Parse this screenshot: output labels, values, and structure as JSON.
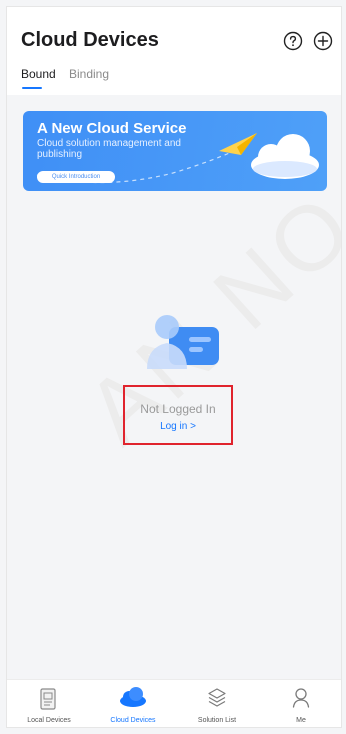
{
  "header": {
    "title": "Cloud Devices",
    "tabs": [
      {
        "label": "Bound",
        "active": true
      },
      {
        "label": "Binding",
        "active": false
      }
    ],
    "icons": [
      "help-circle-icon",
      "add-circle-icon"
    ]
  },
  "banner": {
    "title": "A New Cloud Service",
    "subtitle": "Cloud solution management and publishing",
    "button_label": "Quick Introduction",
    "gradient_colors": [
      "#3f8ff6",
      "#4fa0f8"
    ]
  },
  "empty_state": {
    "status": "Not Logged In",
    "login_link": "Log in >"
  },
  "watermark": "AN NO",
  "bottom_nav": [
    {
      "label": "Local Devices",
      "icon": "local-devices-icon",
      "active": false
    },
    {
      "label": "Cloud Devices",
      "icon": "cloud-icon",
      "active": true
    },
    {
      "label": "Solution List",
      "icon": "layers-icon",
      "active": false
    },
    {
      "label": "Me",
      "icon": "person-icon",
      "active": false
    }
  ],
  "colors": {
    "accent": "#1677ff",
    "highlight_border": "#e0232d",
    "background": "#f4f5f7"
  }
}
